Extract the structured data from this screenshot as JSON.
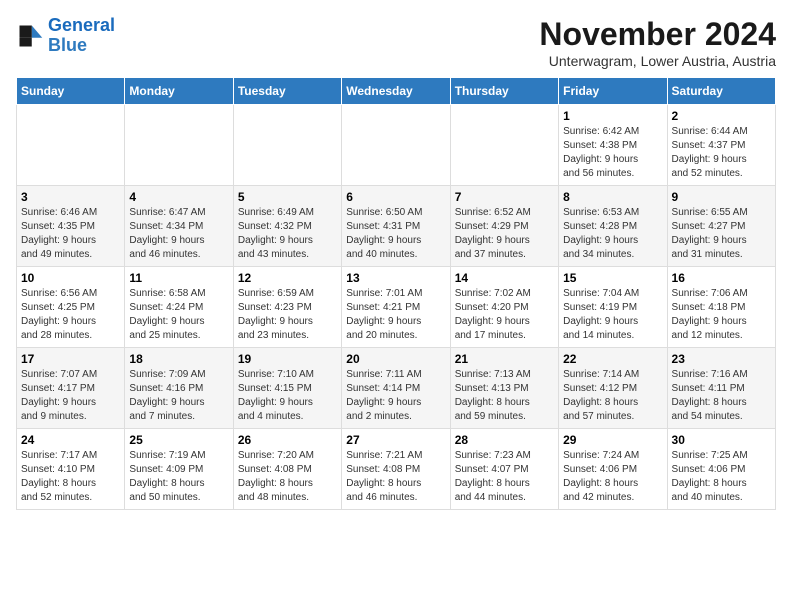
{
  "logo": {
    "line1": "General",
    "line2": "Blue"
  },
  "title": "November 2024",
  "subtitle": "Unterwagram, Lower Austria, Austria",
  "weekdays": [
    "Sunday",
    "Monday",
    "Tuesday",
    "Wednesday",
    "Thursday",
    "Friday",
    "Saturday"
  ],
  "weeks": [
    [
      {
        "day": "",
        "info": ""
      },
      {
        "day": "",
        "info": ""
      },
      {
        "day": "",
        "info": ""
      },
      {
        "day": "",
        "info": ""
      },
      {
        "day": "",
        "info": ""
      },
      {
        "day": "1",
        "info": "Sunrise: 6:42 AM\nSunset: 4:38 PM\nDaylight: 9 hours\nand 56 minutes."
      },
      {
        "day": "2",
        "info": "Sunrise: 6:44 AM\nSunset: 4:37 PM\nDaylight: 9 hours\nand 52 minutes."
      }
    ],
    [
      {
        "day": "3",
        "info": "Sunrise: 6:46 AM\nSunset: 4:35 PM\nDaylight: 9 hours\nand 49 minutes."
      },
      {
        "day": "4",
        "info": "Sunrise: 6:47 AM\nSunset: 4:34 PM\nDaylight: 9 hours\nand 46 minutes."
      },
      {
        "day": "5",
        "info": "Sunrise: 6:49 AM\nSunset: 4:32 PM\nDaylight: 9 hours\nand 43 minutes."
      },
      {
        "day": "6",
        "info": "Sunrise: 6:50 AM\nSunset: 4:31 PM\nDaylight: 9 hours\nand 40 minutes."
      },
      {
        "day": "7",
        "info": "Sunrise: 6:52 AM\nSunset: 4:29 PM\nDaylight: 9 hours\nand 37 minutes."
      },
      {
        "day": "8",
        "info": "Sunrise: 6:53 AM\nSunset: 4:28 PM\nDaylight: 9 hours\nand 34 minutes."
      },
      {
        "day": "9",
        "info": "Sunrise: 6:55 AM\nSunset: 4:27 PM\nDaylight: 9 hours\nand 31 minutes."
      }
    ],
    [
      {
        "day": "10",
        "info": "Sunrise: 6:56 AM\nSunset: 4:25 PM\nDaylight: 9 hours\nand 28 minutes."
      },
      {
        "day": "11",
        "info": "Sunrise: 6:58 AM\nSunset: 4:24 PM\nDaylight: 9 hours\nand 25 minutes."
      },
      {
        "day": "12",
        "info": "Sunrise: 6:59 AM\nSunset: 4:23 PM\nDaylight: 9 hours\nand 23 minutes."
      },
      {
        "day": "13",
        "info": "Sunrise: 7:01 AM\nSunset: 4:21 PM\nDaylight: 9 hours\nand 20 minutes."
      },
      {
        "day": "14",
        "info": "Sunrise: 7:02 AM\nSunset: 4:20 PM\nDaylight: 9 hours\nand 17 minutes."
      },
      {
        "day": "15",
        "info": "Sunrise: 7:04 AM\nSunset: 4:19 PM\nDaylight: 9 hours\nand 14 minutes."
      },
      {
        "day": "16",
        "info": "Sunrise: 7:06 AM\nSunset: 4:18 PM\nDaylight: 9 hours\nand 12 minutes."
      }
    ],
    [
      {
        "day": "17",
        "info": "Sunrise: 7:07 AM\nSunset: 4:17 PM\nDaylight: 9 hours\nand 9 minutes."
      },
      {
        "day": "18",
        "info": "Sunrise: 7:09 AM\nSunset: 4:16 PM\nDaylight: 9 hours\nand 7 minutes."
      },
      {
        "day": "19",
        "info": "Sunrise: 7:10 AM\nSunset: 4:15 PM\nDaylight: 9 hours\nand 4 minutes."
      },
      {
        "day": "20",
        "info": "Sunrise: 7:11 AM\nSunset: 4:14 PM\nDaylight: 9 hours\nand 2 minutes."
      },
      {
        "day": "21",
        "info": "Sunrise: 7:13 AM\nSunset: 4:13 PM\nDaylight: 8 hours\nand 59 minutes."
      },
      {
        "day": "22",
        "info": "Sunrise: 7:14 AM\nSunset: 4:12 PM\nDaylight: 8 hours\nand 57 minutes."
      },
      {
        "day": "23",
        "info": "Sunrise: 7:16 AM\nSunset: 4:11 PM\nDaylight: 8 hours\nand 54 minutes."
      }
    ],
    [
      {
        "day": "24",
        "info": "Sunrise: 7:17 AM\nSunset: 4:10 PM\nDaylight: 8 hours\nand 52 minutes."
      },
      {
        "day": "25",
        "info": "Sunrise: 7:19 AM\nSunset: 4:09 PM\nDaylight: 8 hours\nand 50 minutes."
      },
      {
        "day": "26",
        "info": "Sunrise: 7:20 AM\nSunset: 4:08 PM\nDaylight: 8 hours\nand 48 minutes."
      },
      {
        "day": "27",
        "info": "Sunrise: 7:21 AM\nSunset: 4:08 PM\nDaylight: 8 hours\nand 46 minutes."
      },
      {
        "day": "28",
        "info": "Sunrise: 7:23 AM\nSunset: 4:07 PM\nDaylight: 8 hours\nand 44 minutes."
      },
      {
        "day": "29",
        "info": "Sunrise: 7:24 AM\nSunset: 4:06 PM\nDaylight: 8 hours\nand 42 minutes."
      },
      {
        "day": "30",
        "info": "Sunrise: 7:25 AM\nSunset: 4:06 PM\nDaylight: 8 hours\nand 40 minutes."
      }
    ]
  ]
}
